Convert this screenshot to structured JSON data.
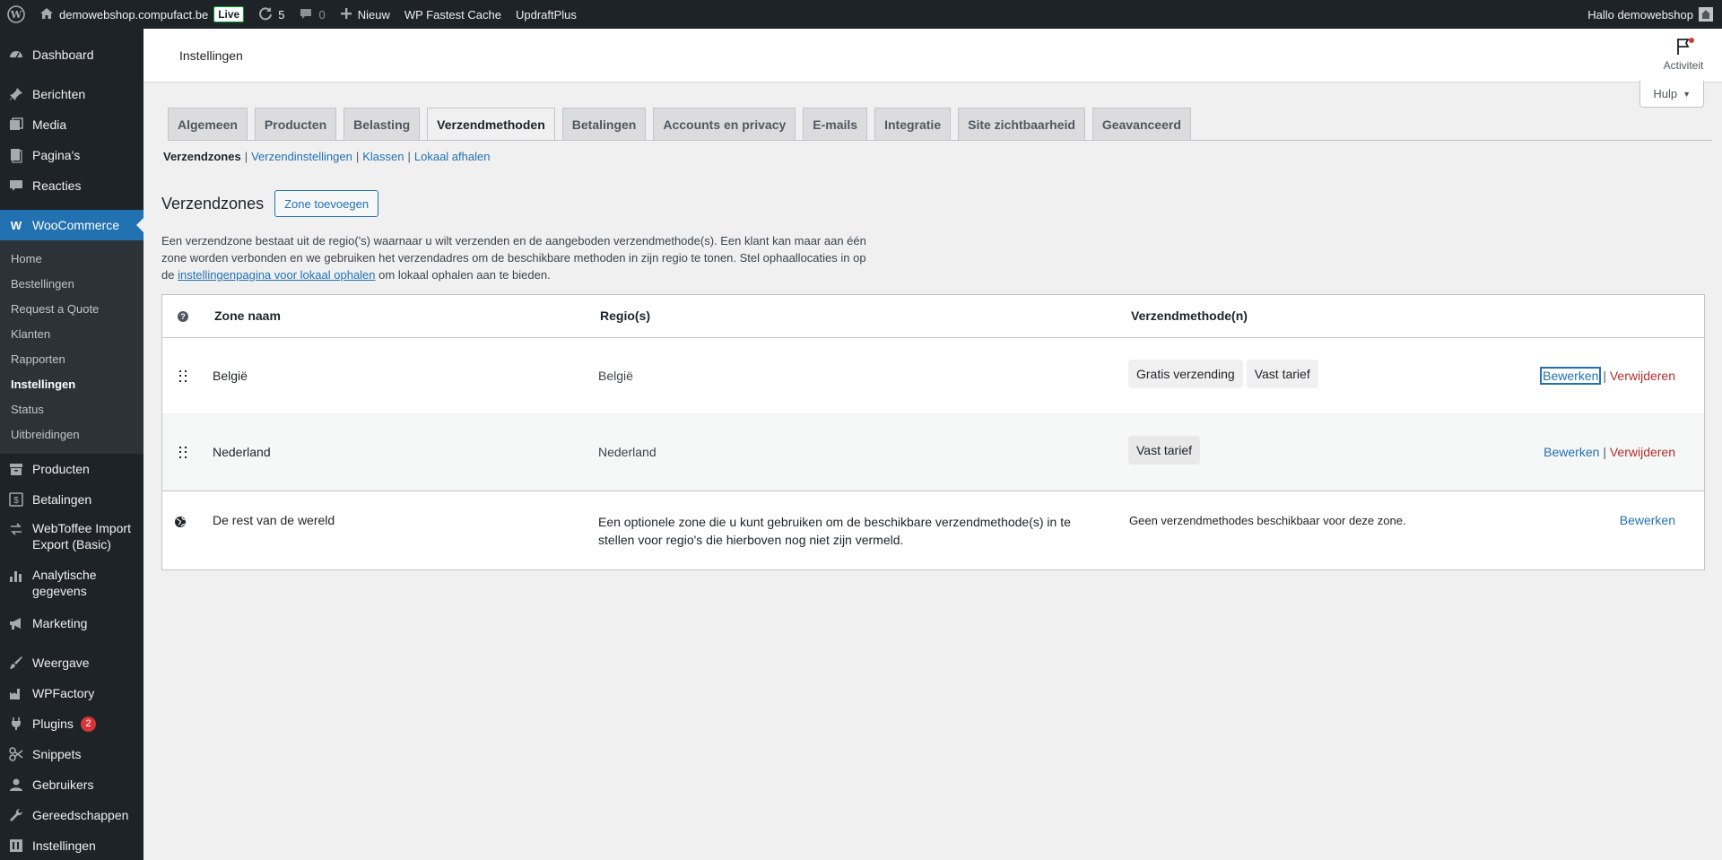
{
  "adminbar": {
    "site_name": "demowebshop.compufact.be",
    "live_label": "Live",
    "updates_count": "5",
    "comments_count": "0",
    "new_label": "Nieuw",
    "plugin1": "WP Fastest Cache",
    "plugin2": "UpdraftPlus",
    "greeting": "Hallo demowebshop"
  },
  "sidebar": {
    "dashboard": "Dashboard",
    "posts": "Berichten",
    "media": "Media",
    "pages": "Pagina's",
    "comments": "Reacties",
    "woocommerce": "WooCommerce",
    "sub": [
      "Home",
      "Bestellingen",
      "Request a Quote",
      "Klanten",
      "Rapporten",
      "Instellingen",
      "Status",
      "Uitbreidingen"
    ],
    "products": "Producten",
    "payments": "Betalingen",
    "webtoffee": "WebToffee Import Export (Basic)",
    "analytics": "Analytische gegevens",
    "marketing": "Marketing",
    "appearance": "Weergave",
    "wpfactory": "WPFactory",
    "plugins": "Plugins",
    "plugins_badge": "2",
    "snippets": "Snippets",
    "users": "Gebruikers",
    "tools": "Gereedschappen",
    "settings": "Instellingen"
  },
  "header": {
    "title": "Instellingen",
    "activity": "Activiteit",
    "help": "Hulp"
  },
  "tabs": [
    "Algemeen",
    "Producten",
    "Belasting",
    "Verzendmethoden",
    "Betalingen",
    "Accounts en privacy",
    "E-mails",
    "Integratie",
    "Site zichtbaarheid",
    "Geavanceerd"
  ],
  "subnav": {
    "current": "Verzendzones",
    "links": [
      "Verzendinstellingen",
      "Klassen",
      "Lokaal afhalen"
    ]
  },
  "section": {
    "title": "Verzendzones",
    "add_button": "Zone toevoegen",
    "desc_part1": "Een verzendzone bestaat uit de regio('s) waarnaar u wilt verzenden en de aangeboden verzendmethode(s). Een klant kan maar aan één zone worden verbonden en we gebruiken het verzendadres om de beschikbare methoden in zijn regio te tonen. Stel ophaallocaties in op de ",
    "desc_link": "instellingenpagina voor lokaal ophalen",
    "desc_part2": " om lokaal ophalen aan te bieden."
  },
  "table": {
    "headers": {
      "name": "Zone naam",
      "regions": "Regio(s)",
      "methods": "Verzendmethode(n)"
    },
    "rows": [
      {
        "name": "België",
        "region": "België",
        "methods": [
          "Gratis verzending",
          "Vast tarief"
        ],
        "edit": "Bewerken",
        "delete": "Verwijderen"
      },
      {
        "name": "Nederland",
        "region": "Nederland",
        "methods": [
          "Vast tarief"
        ],
        "edit": "Bewerken",
        "delete": "Verwijderen"
      }
    ],
    "rest": {
      "name": "De rest van de wereld",
      "region": "Een optionele zone die u kunt gebruiken om de beschikbare verzendmethode(s) in te stellen voor regio's die hierboven nog niet zijn vermeld.",
      "methods": "Geen verzendmethodes beschikbaar voor deze zone.",
      "edit": "Bewerken"
    }
  }
}
